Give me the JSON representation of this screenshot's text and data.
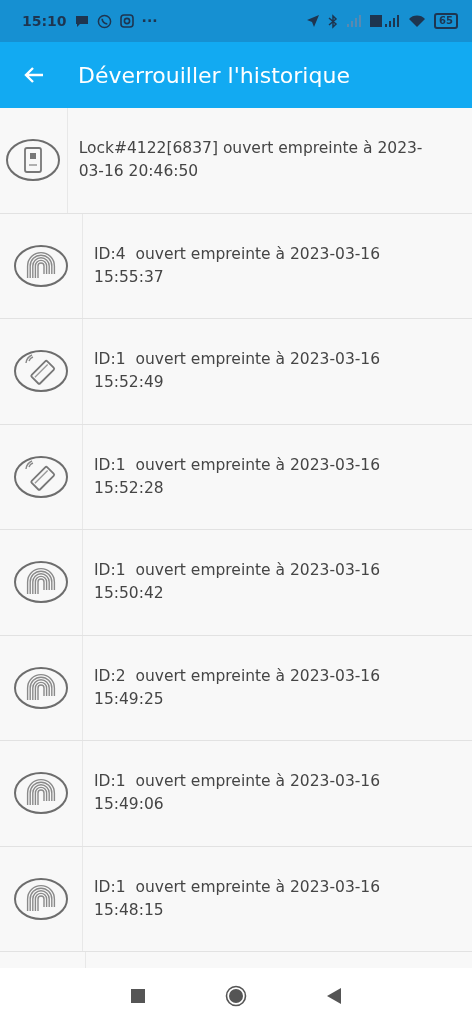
{
  "status_bar": {
    "time": "15:10",
    "more": "···",
    "battery": "65"
  },
  "app_bar": {
    "title": "Déverrouiller l'historique"
  },
  "entries": [
    {
      "kind": "app",
      "text": "Lock#4122[6837] ouvert empreinte à 2023-03-16 20:46:50"
    },
    {
      "kind": "fingerprint",
      "text": "ID:4  ouvert empreinte à 2023-03-16 15:55:37"
    },
    {
      "kind": "card",
      "text": "ID:1  ouvert empreinte à 2023-03-16 15:52:49"
    },
    {
      "kind": "card",
      "text": "ID:1  ouvert empreinte à 2023-03-16 15:52:28"
    },
    {
      "kind": "fingerprint",
      "text": "ID:1  ouvert empreinte à 2023-03-16 15:50:42"
    },
    {
      "kind": "fingerprint",
      "text": "ID:2  ouvert empreinte à 2023-03-16 15:49:25"
    },
    {
      "kind": "fingerprint",
      "text": "ID:1  ouvert empreinte à 2023-03-16 15:49:06"
    },
    {
      "kind": "fingerprint",
      "text": "ID:1  ouvert empreinte à 2023-03-16 15:48:15"
    }
  ]
}
